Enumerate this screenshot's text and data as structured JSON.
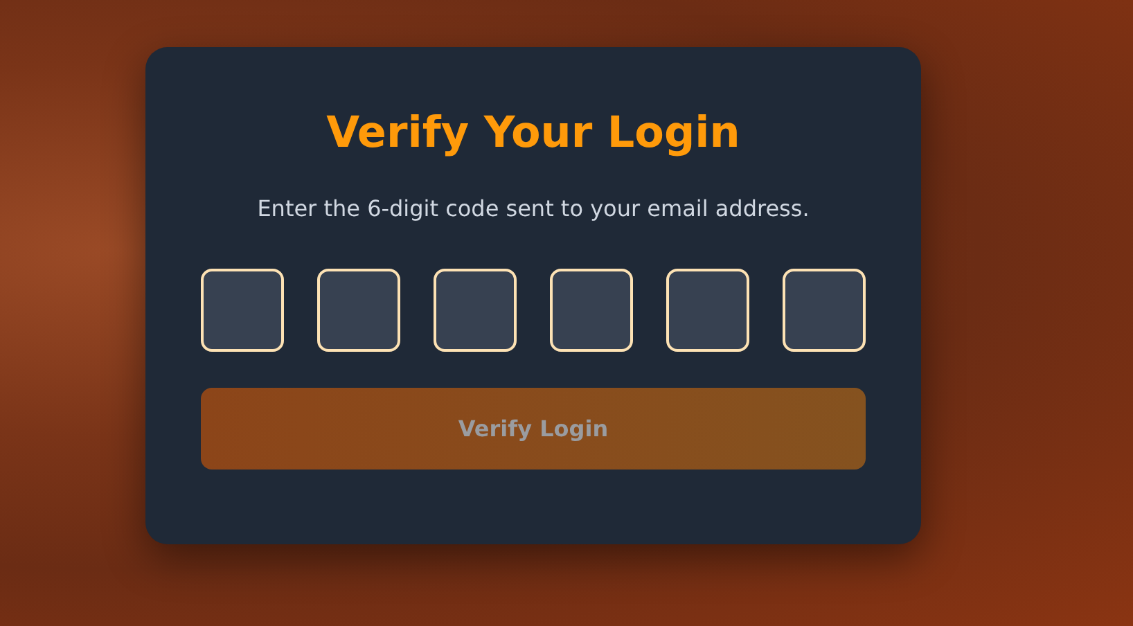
{
  "title": "Verify Your Login",
  "subtitle": "Enter the 6-digit code sent to your email address.",
  "code_fields": [
    {
      "kind": "digit"
    },
    {
      "kind": "digit"
    },
    {
      "kind": "digit"
    },
    {
      "kind": "digit"
    },
    {
      "kind": "digit"
    },
    {
      "kind": "digit"
    }
  ],
  "button": {
    "label": "Verify Login",
    "disabled": true
  }
}
